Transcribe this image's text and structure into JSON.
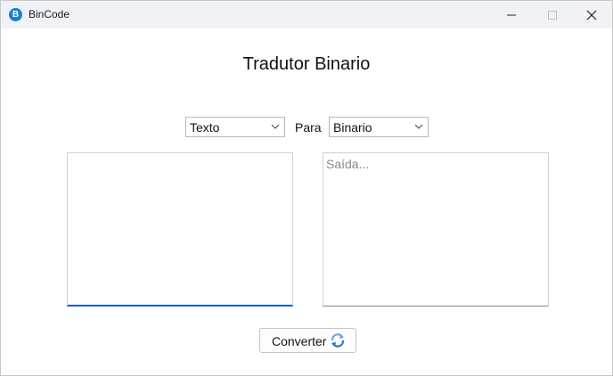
{
  "window": {
    "title": "BinCode",
    "app_icon_letter": "B"
  },
  "main": {
    "heading": "Tradutor Binario",
    "from_select": {
      "value": "Texto"
    },
    "to_label": "Para",
    "to_select": {
      "value": "Binario"
    },
    "input_area": {
      "value": "",
      "placeholder": ""
    },
    "output_area": {
      "value": "",
      "placeholder": "Saída..."
    },
    "convert_button": {
      "label": "Converter",
      "icon": "refresh-icon"
    }
  },
  "colors": {
    "accent": "#0a5fb4",
    "app_icon": "#1683c9",
    "titlebar": "#f0f2f8",
    "refresh_icon_blue": "#2b6fd1",
    "refresh_icon_light": "#6fa3e6"
  }
}
